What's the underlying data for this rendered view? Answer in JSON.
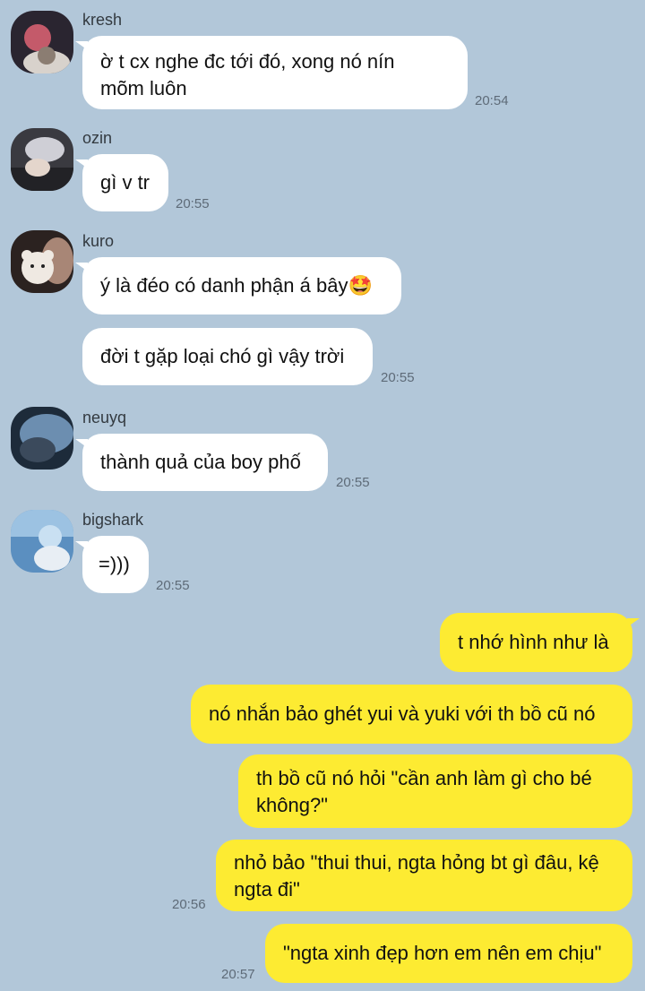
{
  "messages_in": [
    {
      "user": "kresh",
      "lines": [
        "ờ t cx nghe đc tới đó, xong nó nín",
        "mõm luôn"
      ],
      "time": "20:54"
    },
    {
      "user": "ozin",
      "lines": [
        "gì v tr"
      ],
      "time": "20:55"
    },
    {
      "user": "kuro",
      "lines": [
        "ý là đéo có danh phận á bây🤩"
      ],
      "second": "đời t gặp loại chó gì vậy trời",
      "time": "20:55"
    },
    {
      "user": "neuyq",
      "lines": [
        "thành quả của boy phố"
      ],
      "time": "20:55"
    },
    {
      "user": "bigshark",
      "lines": [
        "=)))"
      ],
      "time": "20:55"
    }
  ],
  "messages_out": [
    {
      "text": "t nhớ hình như là"
    },
    {
      "text": "nó nhắn bảo ghét yui và yuki với th bồ cũ nó"
    },
    {
      "line1": "th bồ cũ nó hỏi \"cần anh làm gì cho bé",
      "line2": "không?\""
    },
    {
      "line1": "nhỏ bảo \"thui thui, ngta hỏng bt gì đâu, kệ",
      "line2": "ngta đi\"",
      "time": "20:56"
    },
    {
      "text": "\"ngta xinh đẹp hơn em nên em chịu\"",
      "time": "20:57"
    }
  ],
  "avatar_colors": {
    "kresh": [
      "#2a2530",
      "#c45a6a"
    ],
    "ozin": [
      "#3a3a40",
      "#cfcfd6"
    ],
    "kuro": [
      "#2b2220",
      "#efe9e2"
    ],
    "neuyq": [
      "#1d2b3a",
      "#6c8eb0"
    ],
    "bigshark": [
      "#5b8fc0",
      "#c9e0f2"
    ]
  }
}
